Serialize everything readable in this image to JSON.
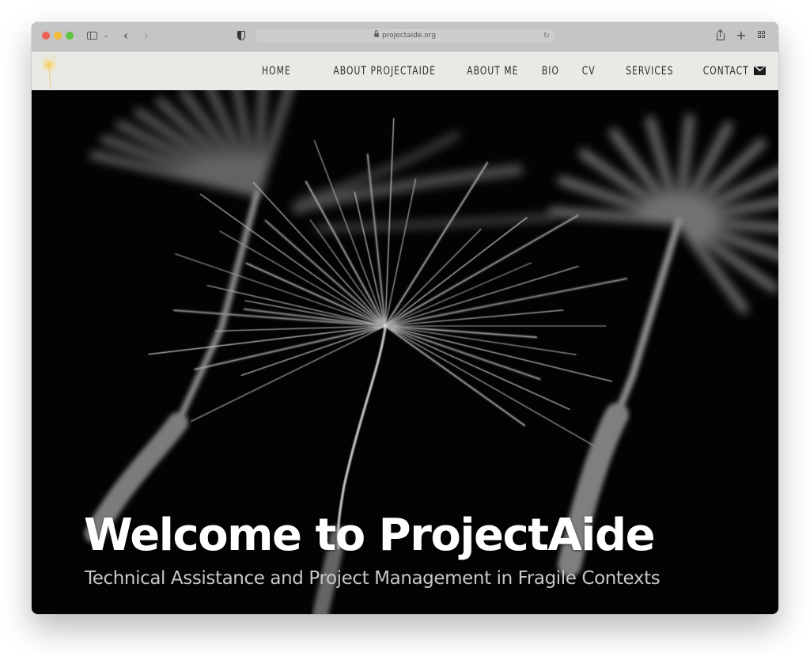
{
  "browser": {
    "url": "projectaide.org",
    "icons": {
      "close": "traffic-light-close",
      "minimize": "traffic-light-minimize",
      "zoom": "traffic-light-zoom",
      "sidebar": "sidebar-icon",
      "sidebar_menu": "chevron-down-icon",
      "back": "chevron-left-icon",
      "forward": "chevron-right-icon",
      "privacy": "shield-icon",
      "lock": "lock-icon",
      "reload": "reload-icon",
      "share": "share-icon",
      "new_tab": "plus-icon",
      "tab_overview": "grid-icon"
    },
    "glyphs": {
      "back": "‹",
      "forward": "›",
      "sidebar_menu": "⌄",
      "new_tab": "+",
      "reload": "↻"
    }
  },
  "site": {
    "logo": "dandelion-logo",
    "nav": {
      "items": [
        {
          "label": "HOME",
          "active": true
        },
        {
          "label": "ABOUT PROJECTAIDE",
          "active": false
        },
        {
          "label": "ABOUT ME",
          "active": false
        },
        {
          "label": "BIO",
          "active": false
        },
        {
          "label": "CV",
          "active": false
        },
        {
          "label": "SERVICES",
          "active": false
        },
        {
          "label": "CONTACT",
          "active": false
        }
      ],
      "mail_icon": "envelope-icon"
    },
    "hero": {
      "title": "Welcome to ProjectAide",
      "subtitle": "Technical Assistance and Project Management in Fragile Contexts",
      "image": "dandelion-seeds-black-and-white"
    }
  },
  "colors": {
    "chrome_bg": "#c5c5c5",
    "nav_bg": "#e9eae6",
    "nav_text": "#2c2c2c",
    "hero_bg": "#030303",
    "hero_title": "#ffffff",
    "hero_subtitle": "#c7c7c7",
    "logo_accent": "#f0c94a"
  }
}
